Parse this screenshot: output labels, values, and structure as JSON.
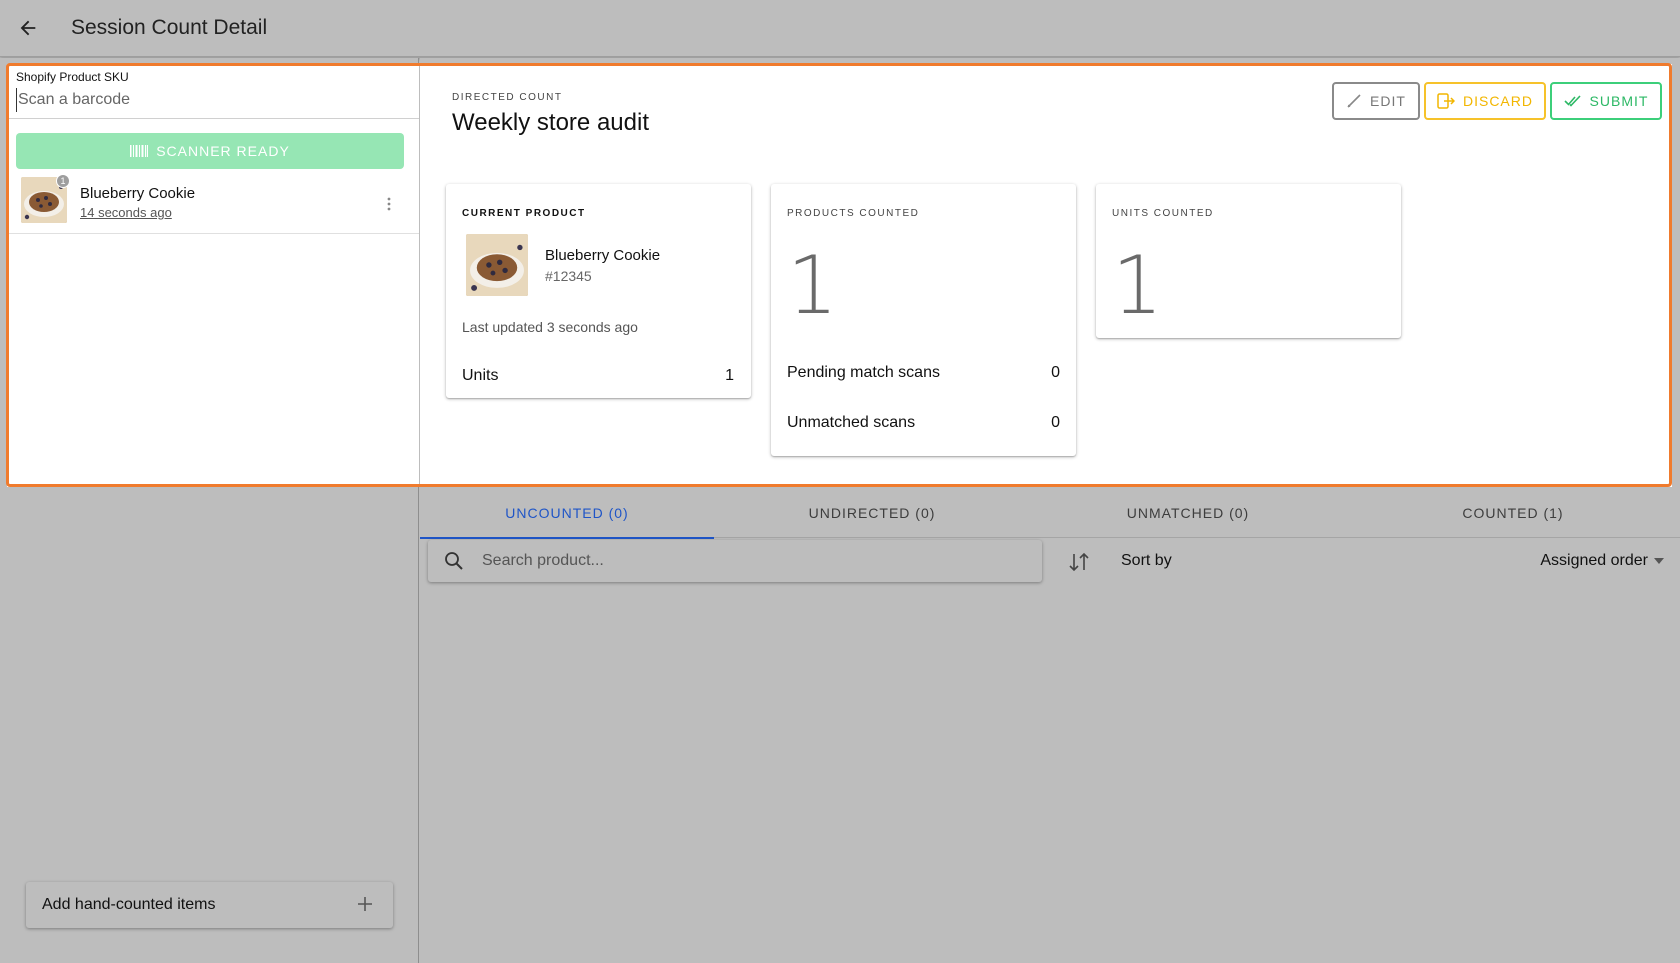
{
  "header": {
    "title": "Session Count Detail",
    "back_icon": "arrow-back-icon"
  },
  "scanner": {
    "sku_label": "Shopify Product SKU",
    "input_placeholder": "Scan a barcode",
    "input_value": "",
    "status_label": "SCANNER READY"
  },
  "recent_scans": [
    {
      "name": "Blueberry Cookie",
      "time": "14 seconds ago",
      "badge": "1"
    }
  ],
  "hand_count": {
    "label": "Add hand-counted items"
  },
  "count": {
    "type_label": "DIRECTED COUNT",
    "title": "Weekly store audit",
    "actions": {
      "edit": "EDIT",
      "discard": "DISCARD",
      "submit": "SUBMIT"
    }
  },
  "current_product": {
    "heading": "CURRENT PRODUCT",
    "name": "Blueberry Cookie",
    "sku": "#12345",
    "last_updated": "Last updated 3 seconds ago",
    "units_label": "Units",
    "units_value": "1"
  },
  "products_counted": {
    "heading": "PRODUCTS COUNTED",
    "value": "1",
    "pending_label": "Pending match scans",
    "pending_value": "0",
    "unmatched_label": "Unmatched scans",
    "unmatched_value": "0"
  },
  "units_counted": {
    "heading": "UNITS COUNTED",
    "value": "1"
  },
  "tabs": [
    {
      "label": "UNCOUNTED (0)",
      "active": true
    },
    {
      "label": "UNDIRECTED (0)",
      "active": false
    },
    {
      "label": "UNMATCHED (0)",
      "active": false
    },
    {
      "label": "COUNTED (1)",
      "active": false
    }
  ],
  "list_controls": {
    "search_placeholder": "Search product...",
    "sort_label": "Sort by",
    "sort_value": "Assigned order"
  },
  "colors": {
    "highlight": "#f07b2d",
    "scanner_ready": "#96e6b4",
    "discard": "#f2b600",
    "submit": "#2cb865",
    "active_tab": "#1f55c7"
  }
}
